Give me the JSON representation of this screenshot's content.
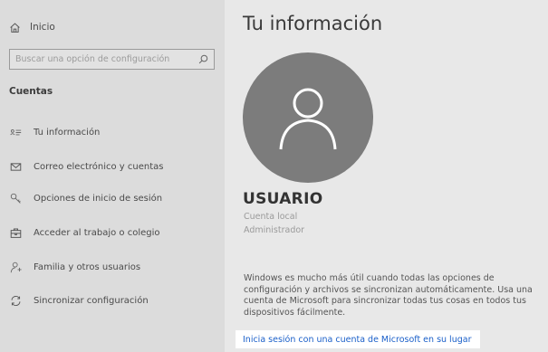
{
  "sidebar": {
    "home_label": "Inicio",
    "search_placeholder": "Buscar una opción de configuración",
    "section_title": "Cuentas",
    "items": [
      {
        "label": "Tu información",
        "icon": "user-info-icon"
      },
      {
        "label": "Correo electrónico y cuentas",
        "icon": "mail-icon"
      },
      {
        "label": "Opciones de inicio de sesión",
        "icon": "key-icon"
      },
      {
        "label": "Acceder al trabajo o colegio",
        "icon": "briefcase-icon"
      },
      {
        "label": "Familia y otros usuarios",
        "icon": "person-add-icon"
      },
      {
        "label": "Sincronizar configuración",
        "icon": "sync-icon"
      }
    ]
  },
  "main": {
    "title": "Tu información",
    "username": "USUARIO",
    "account_type": "Cuenta local",
    "account_role": "Administrador",
    "info_text": "Windows es mucho más útil cuando todas las opciones de configuración y archivos se sincronizan automáticamente. Usa una cuenta de Microsoft para sincronizar todas tus cosas en todos tus dispositivos fácilmente.",
    "signin_link": "Inicia sesión con una cuenta de Microsoft en su lugar"
  },
  "colors": {
    "sidebar_bg": "#dcdcdc",
    "main_bg": "#e8e8e8",
    "avatar_bg": "#7c7c7c",
    "link": "#1a5fc9"
  }
}
